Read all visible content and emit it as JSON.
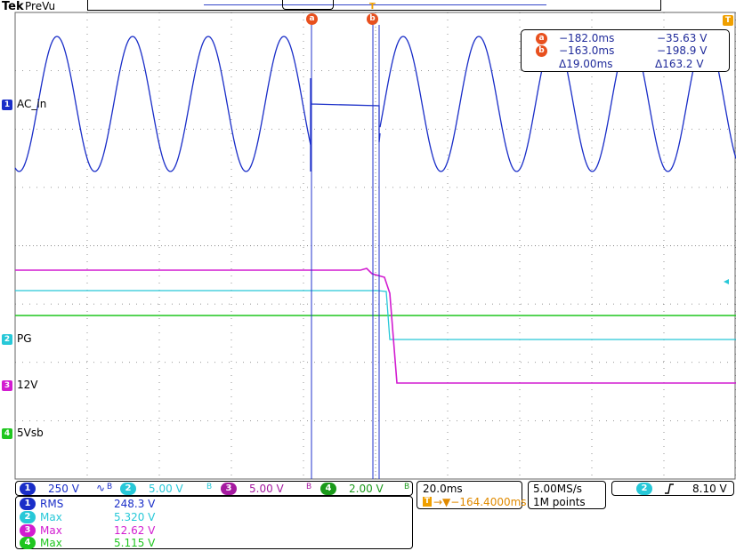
{
  "header": {
    "brand": "Tek",
    "mode": "PreVu"
  },
  "cursors": {
    "a_label": "a",
    "b_label": "b",
    "trigger_label": "T"
  },
  "channels": {
    "ch1": {
      "num": "1",
      "name": "AC_in",
      "color": "#1a2ec8"
    },
    "ch2": {
      "num": "2",
      "name": "PG",
      "color": "#27c8d8"
    },
    "ch3": {
      "num": "3",
      "name": "12V",
      "color": "#d21cd0"
    },
    "ch4": {
      "num": "4",
      "name": "5Vsb",
      "color": "#1fc61f"
    }
  },
  "readout": {
    "a_time": "−182.0ms",
    "a_val": "−35.63 V",
    "b_time": "−163.0ms",
    "b_val": "−198.9 V",
    "d_time": "Δ19.00ms",
    "d_val": "Δ163.2 V"
  },
  "scales": {
    "ch1": "250 V",
    "ch2": "5.00 V",
    "ch3": "5.00 V",
    "ch4": "2.00 V",
    "bw_icon": "B",
    "ac_icon": "∿"
  },
  "measurements": [
    {
      "ch": "1",
      "type": "RMS",
      "value": "248.3 V",
      "color": "#1a2ec8"
    },
    {
      "ch": "2",
      "type": "Max",
      "value": "5.320 V",
      "color": "#27c8d8"
    },
    {
      "ch": "3",
      "type": "Max",
      "value": "12.62 V",
      "color": "#d21cd0"
    },
    {
      "ch": "4",
      "type": "Max",
      "value": "5.115 V",
      "color": "#1fc61f"
    }
  ],
  "timebase": {
    "scale": "20.0ms",
    "position": "→▼−164.4000ms"
  },
  "acquisition": {
    "rate": "5.00MS/s",
    "points": "1M points"
  },
  "trigger": {
    "channel": "2",
    "slope_icon": "rising-edge",
    "level": "8.10 V"
  },
  "colors": {
    "cursor_badge": "#e8501e",
    "trigger": "#f0a000",
    "grid": "#555555"
  }
}
